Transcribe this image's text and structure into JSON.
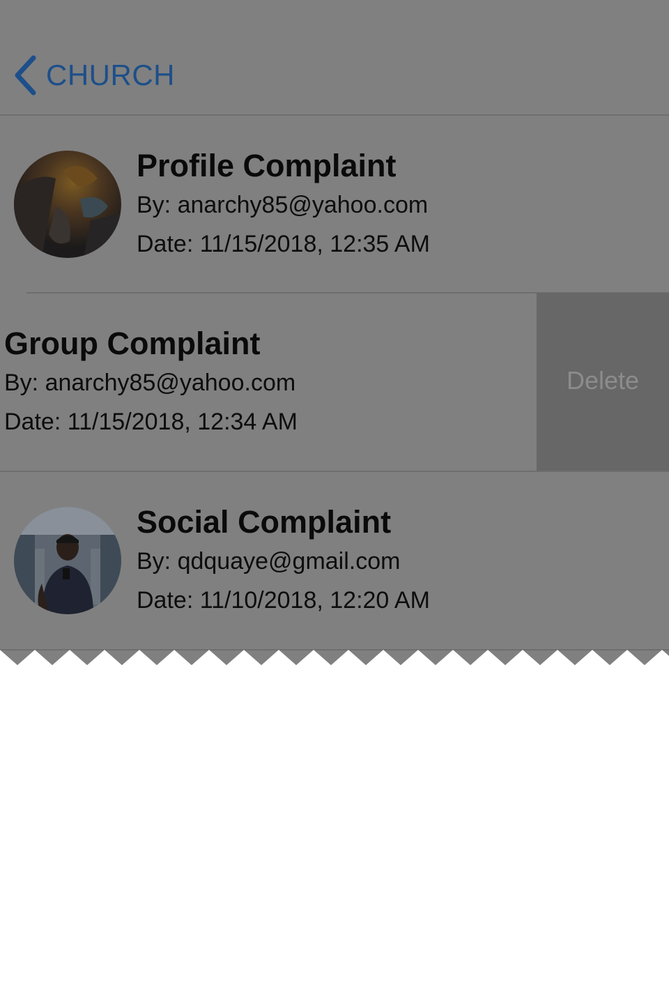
{
  "nav": {
    "back_label": "CHURCH",
    "accent_color": "#1d4f8a"
  },
  "complaints": [
    {
      "title": "Profile Complaint",
      "by": "By: anarchy85@yahoo.com",
      "date": "Date: 11/15/2018, 12:35 AM",
      "avatar": "fantasy-artwork-avatar"
    },
    {
      "title": "Group Complaint",
      "by": "By: anarchy85@yahoo.com",
      "date": "Date: 11/15/2018, 12:34 AM",
      "swiped": true,
      "delete_label": "Delete"
    },
    {
      "title": "Social Complaint",
      "by": "By: qdquaye@gmail.com",
      "date": "Date: 11/10/2018, 12:20 AM",
      "avatar": "person-selfie-avatar"
    }
  ],
  "colors": {
    "dimmed_background": "#808080",
    "delete_background": "#676767"
  }
}
